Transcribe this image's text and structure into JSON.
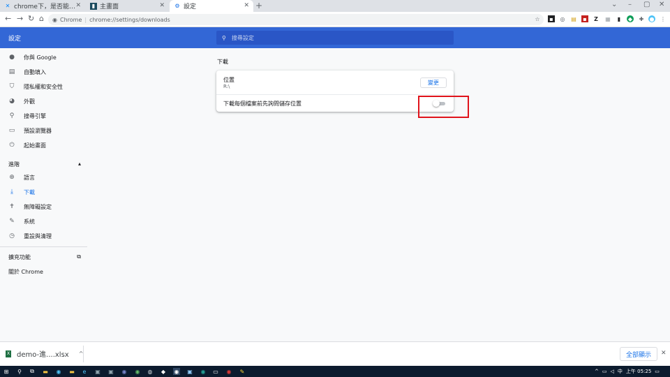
{
  "tabs": [
    {
      "title": "chrome下，是否能…",
      "icon": "zhihu-icon",
      "active": false
    },
    {
      "title": "主畫面",
      "icon": "notebook-icon",
      "active": false
    },
    {
      "title": "設定",
      "icon": "settings-icon",
      "active": true
    }
  ],
  "window_controls": {
    "menu": "⌄",
    "minimize": "–",
    "maximize": "▢",
    "close": "✕"
  },
  "omnibox": {
    "site_label": "Chrome",
    "url": "chrome://settings/downloads"
  },
  "extensions": [
    "Z"
  ],
  "header": {
    "title": "設定",
    "search_placeholder": "搜尋設定"
  },
  "sidebar": {
    "items": [
      {
        "label": "你與 Google",
        "icon": "person-icon"
      },
      {
        "label": "自動填入",
        "icon": "clipboard-icon"
      },
      {
        "label": "隱私權和安全性",
        "icon": "shield-icon"
      },
      {
        "label": "外觀",
        "icon": "palette-icon"
      },
      {
        "label": "搜尋引擎",
        "icon": "search-icon"
      },
      {
        "label": "預設瀏覽器",
        "icon": "browser-icon"
      },
      {
        "label": "起始畫面",
        "icon": "power-icon"
      }
    ],
    "advanced_label": "進階",
    "advanced_items": [
      {
        "label": "語言",
        "icon": "globe-icon"
      },
      {
        "label": "下載",
        "icon": "download-icon",
        "active": true
      },
      {
        "label": "無障礙設定",
        "icon": "accessibility-icon"
      },
      {
        "label": "系統",
        "icon": "wrench-icon"
      },
      {
        "label": "重設與清理",
        "icon": "history-icon"
      }
    ],
    "extensions_label": "擴充功能",
    "about_label": "關於 Chrome"
  },
  "main": {
    "section_title": "下載",
    "location_label": "位置",
    "location_value": "R:\\",
    "change_button": "變更",
    "ask_label": "下載每個檔案前先詢問儲存位置",
    "ask_enabled": false
  },
  "download_shelf": {
    "file_name": "demo-進....xlsx",
    "show_all": "全部顯示"
  },
  "taskbar": {
    "time": "上午 05:25"
  },
  "colors": {
    "header_blue": "#3367d6",
    "accent_blue": "#1a73e8",
    "highlight_red": "#e0131b"
  }
}
